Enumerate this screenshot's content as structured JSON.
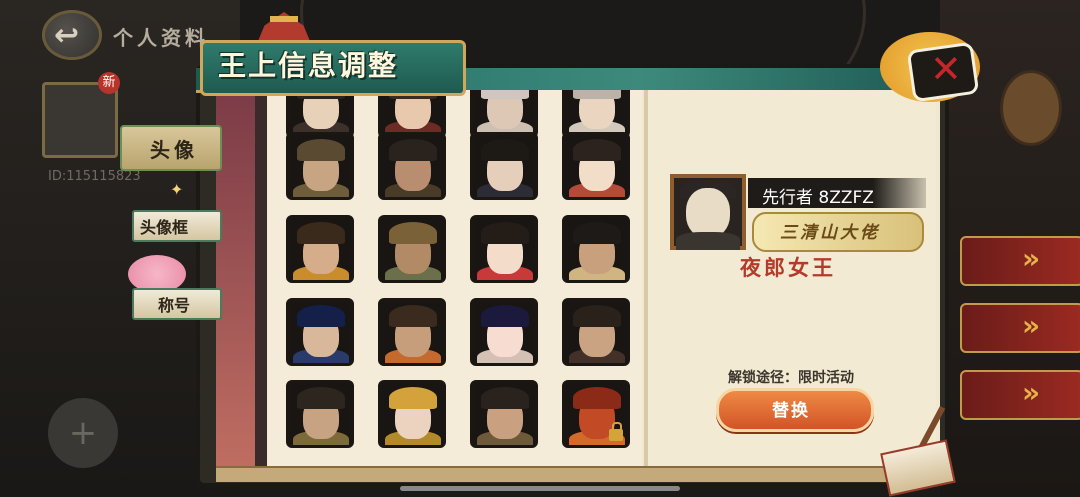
{
  "background": {
    "page_title": "个人资料",
    "user_id": "ID:115115823",
    "new_badge": "新",
    "plus_label": "+",
    "back_arrow": "↩",
    "right_buttons": [
      "",
      "",
      ""
    ],
    "right_button_glyphs": [
      "»",
      "»",
      "»"
    ]
  },
  "dialog": {
    "title": "王上信息调整",
    "close_label": "✕"
  },
  "tabs": {
    "avatar": "头像",
    "avatar_frame": "头像框",
    "title": "称号"
  },
  "avatar_grid": {
    "rows": [
      [
        "#e7d2b9",
        "#e9c9ae",
        "#dcc8b4",
        "#ead6c0"
      ],
      [
        "#c7a583",
        "#b98e70",
        "#e6cfba",
        "#f2ddc9"
      ],
      [
        "#d6ad8a",
        "#b28a66",
        "#f3ddca",
        "#c9a07e"
      ],
      [
        "#d8b79a",
        "#c79e7c",
        "#f7dcd2",
        "#caa383"
      ],
      [
        "#c7a383",
        "#ecd3bf",
        "#c9a180",
        "#c24a24"
      ]
    ],
    "hair_colors": [
      [
        "#2b2521",
        "#3a2b23",
        "#cfc7bf",
        "#bbb2a8"
      ],
      [
        "#5a4a32",
        "#2a221c",
        "#1d1915",
        "#2c231e"
      ],
      [
        "#3a2a1c",
        "#7a6138",
        "#241c16",
        "#1e1a17"
      ],
      [
        "#15204a",
        "#3b2a1e",
        "#1b1a3c",
        "#2a211b"
      ],
      [
        "#2d261f",
        "#d4a23a",
        "#2a221d",
        "#8c2a18"
      ]
    ],
    "body_colors": [
      [
        "#3d2f2a",
        "#6c2b24",
        "#cdbfb2",
        "#d2c8bb"
      ],
      [
        "#6d5d3b",
        "#4a3a28",
        "#2c2c36",
        "#b44a39"
      ],
      [
        "#c98d2e",
        "#6b6f4a",
        "#c83a3a",
        "#d0b482"
      ],
      [
        "#2a3a6a",
        "#c46a2e",
        "#d4c0b5",
        "#433129"
      ],
      [
        "#7c6a3a",
        "#b18a2a",
        "#6e5a3a",
        "#d46a2a"
      ]
    ],
    "locked": [
      [
        false,
        false,
        false,
        false
      ],
      [
        false,
        false,
        false,
        false
      ],
      [
        false,
        false,
        false,
        false
      ],
      [
        false,
        false,
        false,
        false
      ],
      [
        false,
        false,
        false,
        true
      ]
    ]
  },
  "detail": {
    "player_name": "先行者 8ZZFZ",
    "title_plaque": "三清山大佬",
    "character_name": "夜郎女王",
    "unlock_method": "解锁途径：限时活动",
    "replace_button": "替换"
  }
}
